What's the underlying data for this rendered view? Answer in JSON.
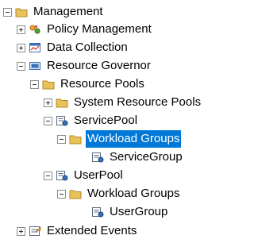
{
  "tree": {
    "management": "Management",
    "policy_management": "Policy Management",
    "data_collection": "Data Collection",
    "resource_governor": "Resource Governor",
    "resource_pools": "Resource Pools",
    "system_resource_pools": "System Resource Pools",
    "service_pool": "ServicePool",
    "workload_groups_service": "Workload Groups",
    "service_group": "ServiceGroup",
    "user_pool": "UserPool",
    "workload_groups_user": "Workload Groups",
    "user_group": "UserGroup",
    "extended_events": "Extended Events"
  },
  "selected_node": "workload_groups_service"
}
